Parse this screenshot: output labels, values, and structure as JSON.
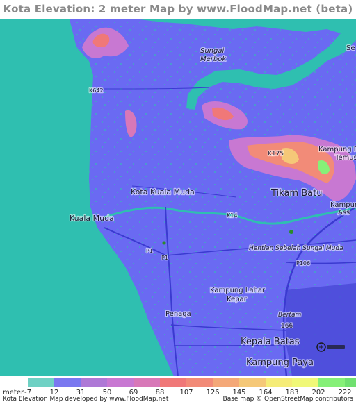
{
  "title": "Kota Elevation: 2 meter Map by www.FloodMap.net (beta)",
  "colors": {
    "sea": "#2fbfb0",
    "lowland": "#6a6af2",
    "road": "#3a3ad0",
    "river": "#2fbfb0"
  },
  "map": {
    "labels": {
      "k642": "K642",
      "sungai_merbok": "Sungai\nMerbok",
      "sungai": "Sungai",
      "merbok": "Merbok",
      "k175": "K175",
      "kampung_temus_1": "Kampung P",
      "kampung_temus_2": "Temus",
      "kota_kuala_muda": "Kota Kuala Muda",
      "tikam_batu": "Tikam Batu",
      "kuala_muda": "Kuala Muda",
      "k14": "K14",
      "kampung_ass_1": "Kampun",
      "kampung_ass_2": "Ass",
      "hentian": "Hentian Sebelah Sungai Muda",
      "p1a": "P1",
      "p1b": "P1",
      "p106": "P106",
      "kampung_lahar_kepar_1": "Kampung Lahar",
      "kampung_lahar_kepar_2": "Kepar",
      "penaga": "Penaga",
      "bertam": "Bertam",
      "route_166": "166",
      "kepala_batas": "Kepala Batas",
      "kampung_paya": "Kampung Paya",
      "se": "Se"
    },
    "osm_logo_icon": "openstreetmap-logo-icon"
  },
  "legend": {
    "unit": "meter",
    "ticks": [
      "-7",
      "12",
      "31",
      "50",
      "69",
      "88",
      "107",
      "126",
      "145",
      "164",
      "183",
      "202",
      "222"
    ],
    "colors": [
      "#6fd1c4",
      "#7a78f0",
      "#ae78d6",
      "#c878d2",
      "#d878b8",
      "#f07878",
      "#f28b78",
      "#f4a878",
      "#f5c878",
      "#f5ec78",
      "#f0f878",
      "#86f078",
      "#70e070"
    ]
  },
  "footer": {
    "left": "Kota Elevation Map developed by www.FloodMap.net",
    "right": "Base map © OpenStreetMap contributors"
  }
}
